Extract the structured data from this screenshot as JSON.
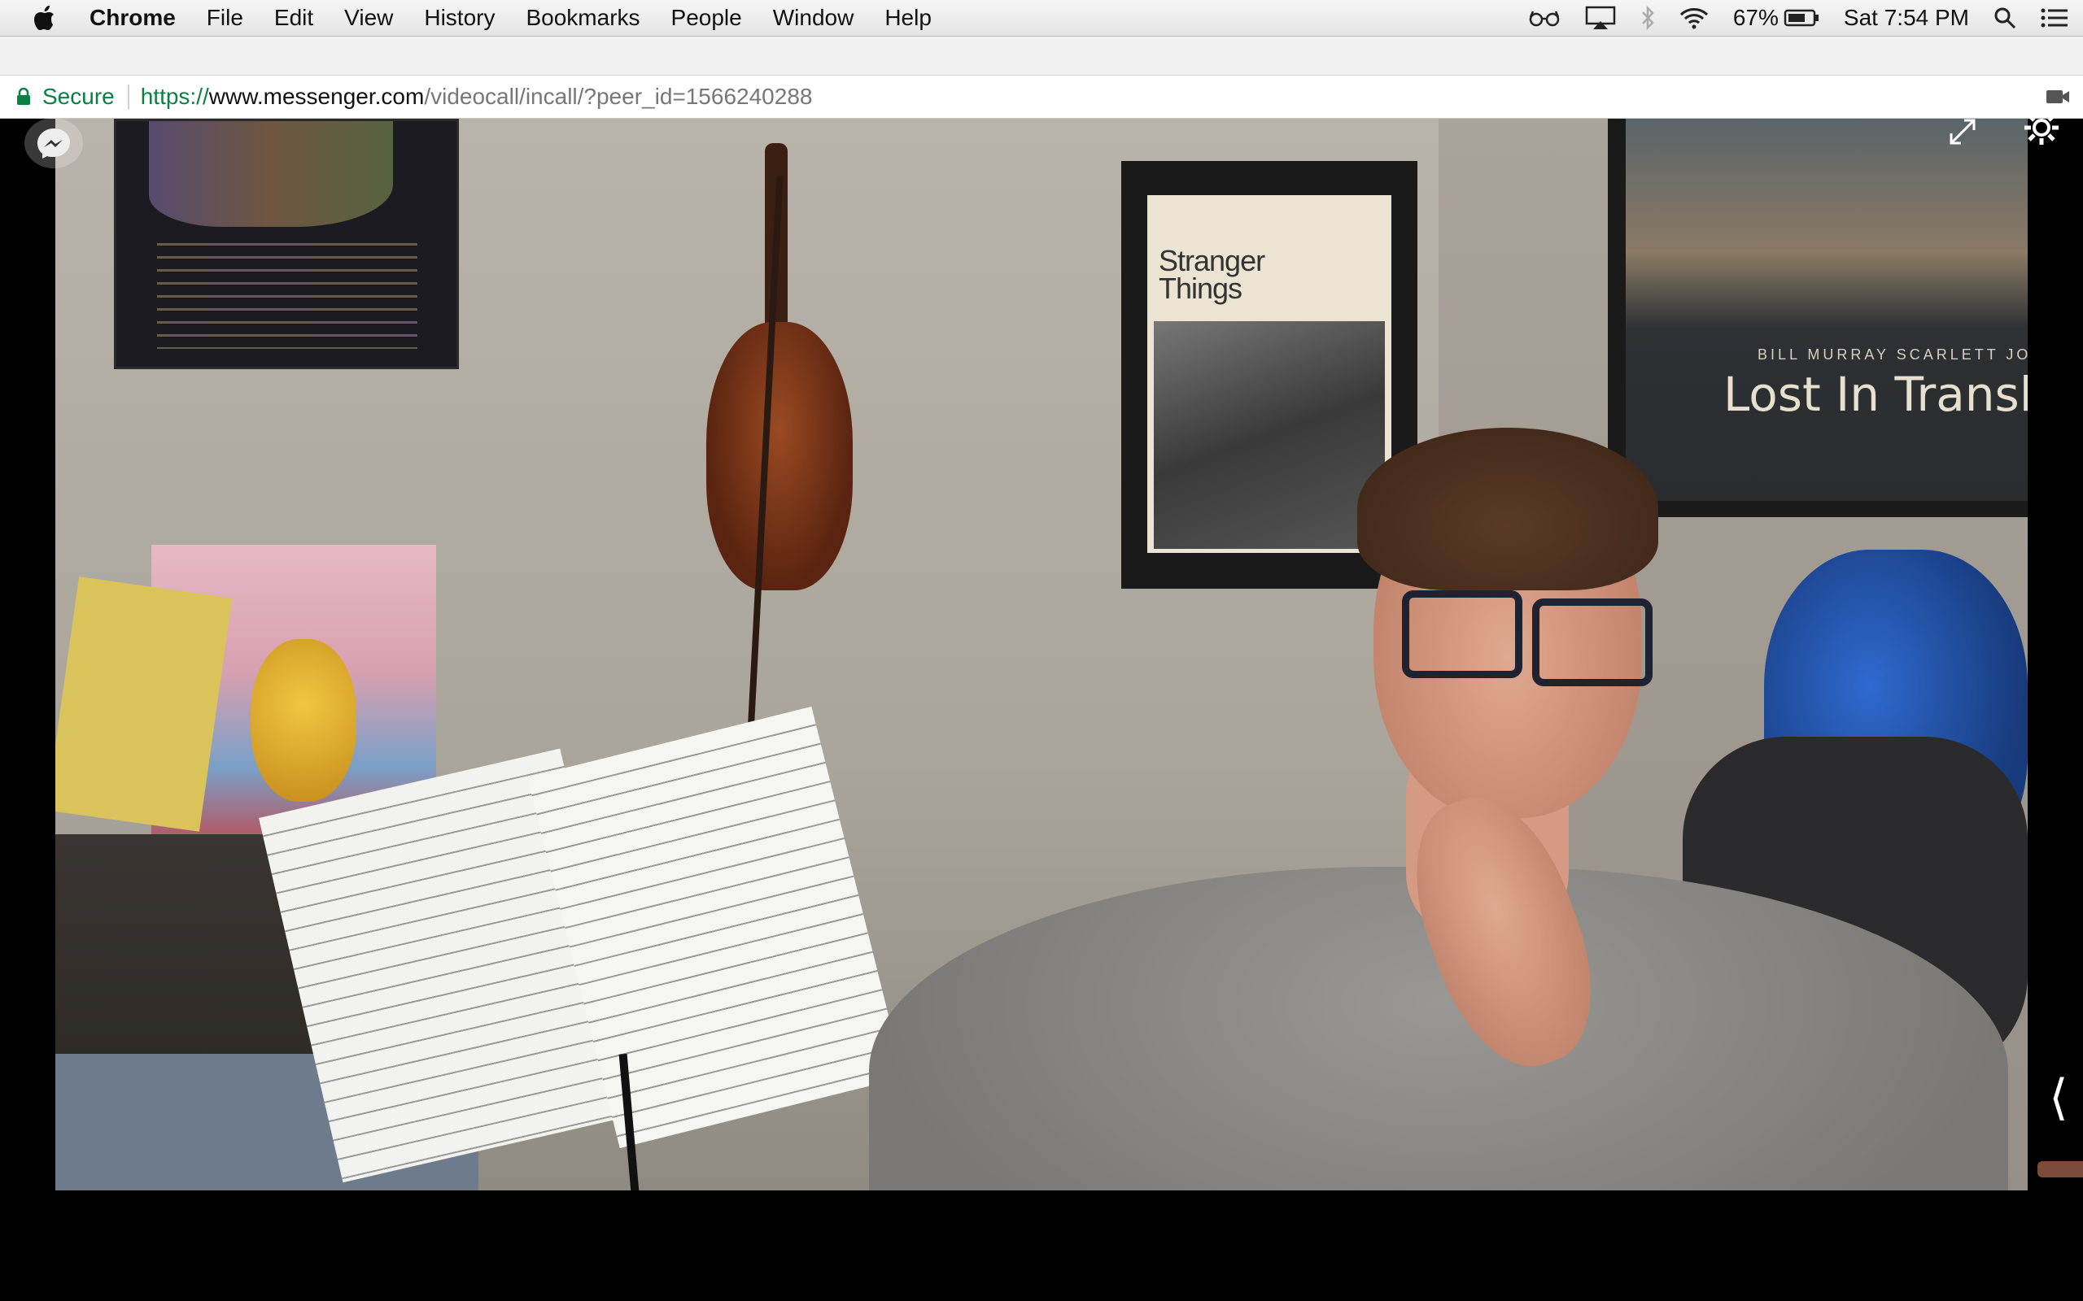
{
  "menubar": {
    "app_name": "Chrome",
    "items": [
      "File",
      "Edit",
      "View",
      "History",
      "Bookmarks",
      "People",
      "Window",
      "Help"
    ],
    "battery": "67%",
    "clock": "Sat 7:54 PM",
    "icons": [
      "apple-icon",
      "glasses-icon",
      "airplay-icon",
      "bluetooth-icon",
      "wifi-icon",
      "battery-icon",
      "spotlight-icon",
      "notification-center-icon"
    ]
  },
  "address_bar": {
    "secure_label": "Secure",
    "url_scheme": "https://",
    "url_host": "www.messenger.com",
    "url_path": "/videocall/incall/?peer_id=1566240288"
  },
  "video": {
    "poster_stranger_things": "Stranger Things",
    "poster_lost_credits": "BILL MURRAY   SCARLETT JOHANS",
    "poster_lost_title": "Lost In Transla",
    "collapse_glyph": "⟨"
  },
  "colors": {
    "secure_green": "#0b8043",
    "menubar_bg": "#ececec",
    "video_bg": "#000000"
  }
}
